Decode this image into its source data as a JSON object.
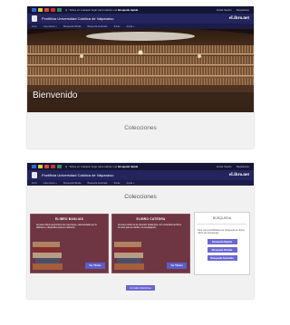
{
  "topbar": {
    "flag_colors": [
      "#2c6ad6",
      "#e8c43a",
      "#d84a3a",
      "#c8342e",
      "#3a8a5a"
    ],
    "search_prefix": "Q",
    "search_text": "Teclee en cualquier lugar para realizar una",
    "search_bold": "búsqueda rápida",
    "login": "Iniciar Sesión",
    "register": "Registrarse"
  },
  "brand": {
    "university": "Pontificia Universidad Católica de Valparaíso",
    "logo": "eLibro.net"
  },
  "nav": {
    "items": [
      "Inicio",
      "Colecciones ∨",
      "Búsqueda Filtrada",
      "Búsqueda Avanzada",
      "Temas",
      "Ayuda ∨"
    ]
  },
  "hero": {
    "title": "Bienvenido"
  },
  "collections": {
    "title": "Colecciones",
    "cards": [
      {
        "title": "ELIBRO BAGLIAS",
        "description": "Acceda a libros electrónicos de colecciones, seleccionados por la biblioteca y disponibles para su institución.",
        "button": "Ver Títulos"
      },
      {
        "title": "ELIBRO CATEDRA",
        "description": "Acceda a títulos de la colección académica, con contenidos de libros de texto para el estudio y la investigación.",
        "button": "Ver Títulos"
      }
    ],
    "all_button": "Ver todas Colecciones"
  },
  "search_panel": {
    "title": "BÚSQUEDA",
    "text": "Para más posibilidades de búsqueda de títulos, utilice las búsquedas.",
    "buttons": [
      "Búsqueda Rápida",
      "Búsqueda Filtrada",
      "Búsqueda Avanzada"
    ]
  }
}
